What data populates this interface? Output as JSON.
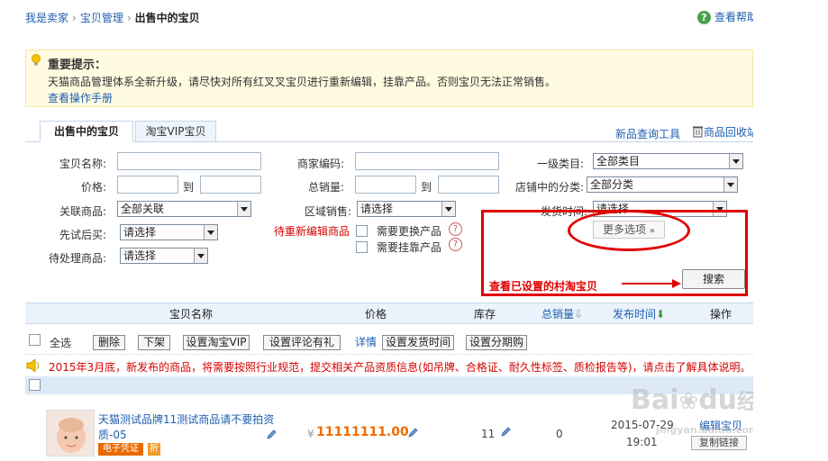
{
  "breadcrumb": {
    "item1": "我是卖家",
    "item2": "宝贝管理",
    "current": "出售中的宝贝",
    "sep": "›"
  },
  "help": {
    "label": "查看帮助"
  },
  "notice": {
    "title": "重要提示：",
    "text": "天猫商品管理体系全新升级，请尽快对所有红叉叉宝贝进行重新编辑，挂靠产品。否则宝贝无法正常销售。",
    "link": "查看操作手册"
  },
  "tabs": [
    {
      "label": "出售中的宝贝"
    },
    {
      "label": "淘宝VIP宝贝"
    }
  ],
  "toplinks": {
    "query_tool": "新品查询工具",
    "recycle": "商品回收站"
  },
  "form": {
    "item_name": "宝贝名称:",
    "merchant_code": "商家编码:",
    "category1": "一级类目:",
    "category1_value": "全部类目",
    "price": "价格:",
    "to1": "到",
    "total_sales": "总销量:",
    "to2": "到",
    "shop_category": "店铺中的分类:",
    "shop_category_value": "全部分类",
    "related": "关联商品:",
    "related_value": "全部关联",
    "region_sale": "区域销售:",
    "region_sale_value": "请选择",
    "ship_time": "发货时间:",
    "ship_time_value": "请选择",
    "try_first": "先试后买:",
    "try_first_value": "请选择",
    "pending_reedit": "待重新编辑商品",
    "need_replace": "需要更换产品",
    "need_attach": "需要挂靠产品",
    "pending_items": "待处理商品:",
    "pending_items_value": "请选择",
    "more_options": "更多选项",
    "search": "搜索"
  },
  "annotation": {
    "text": "查看已设置的村淘宝贝"
  },
  "table": {
    "headers": {
      "name": "宝贝名称",
      "price": "价格",
      "stock": "库存",
      "total_sales": "总销量",
      "publish_time": "发布时间",
      "action": "操作"
    }
  },
  "toolbar": {
    "select_all": "全选",
    "delete": "删除",
    "delist": "下架",
    "set_vip": "设置淘宝VIP",
    "set_review": "设置评论有礼",
    "detail": "详情",
    "set_ship_time": "设置发货时间",
    "set_installment": "设置分期购"
  },
  "warning": {
    "text": "2015年3月底，新发布的商品，将需要按照行业规范，提交相关产品资质信息(如吊牌、合格证、耐久性标签、质检报告等)，请点击了解具体说明。"
  },
  "product": {
    "title_line1": "天猫测试品牌11测试商品请不要拍资",
    "title_line2": "质-05",
    "currency": "¥",
    "price": "11111111.00",
    "stock": "11",
    "sales": "0",
    "date": "2015-07-29",
    "time": "19:01",
    "edit": "编辑宝贝",
    "copy": "复制链接",
    "badge1": "电子凭证",
    "badge2": "折"
  },
  "watermark": {
    "brand": "Bai",
    "brand2": "du",
    "suffix": "经验",
    "url": "jingyan.baidu.com"
  },
  "colors": {
    "link": "#1e5eb0",
    "warning": "#d40000",
    "annotation": "#e00000",
    "price": "#f26a00"
  }
}
